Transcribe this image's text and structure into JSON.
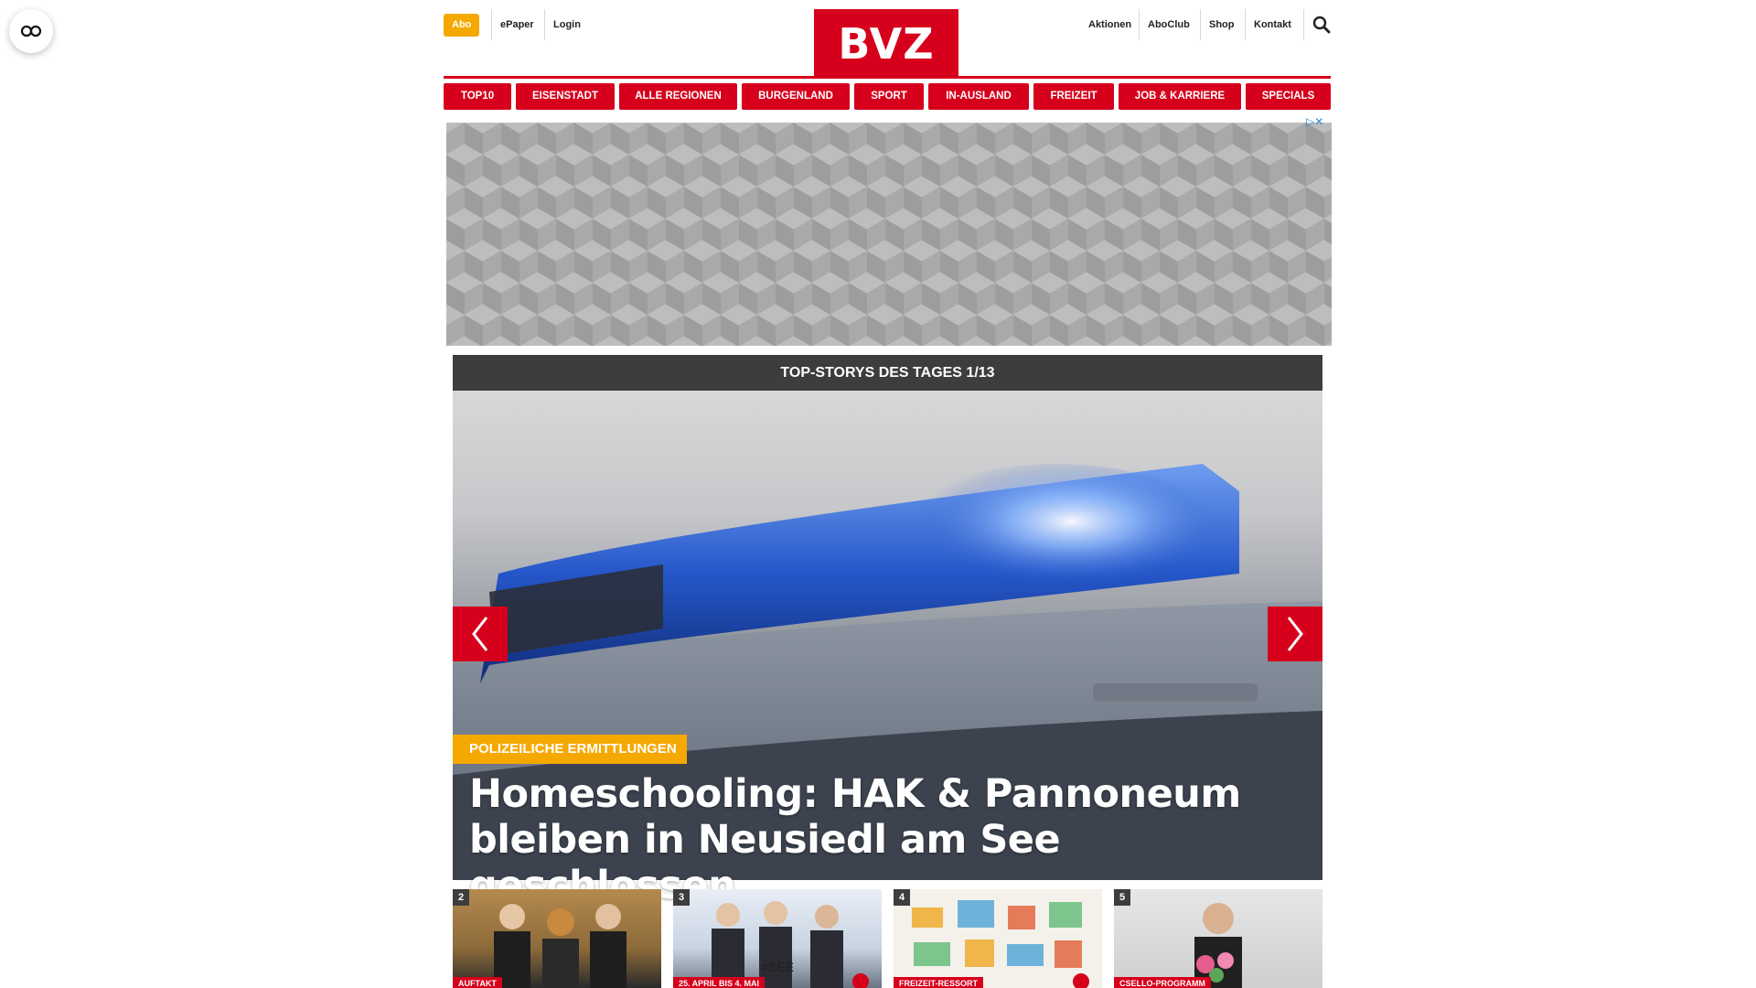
{
  "header": {
    "abo_label": "Abo",
    "epaper_label": "ePaper",
    "login_label": "Login",
    "logo_text": "BVZ",
    "right_links": [
      "Aktionen",
      "AboClub",
      "Shop",
      "Kontakt"
    ],
    "search_icon": "search-icon"
  },
  "nav": {
    "items": [
      "TOP10",
      "EISENSTADT",
      "ALLE REGIONEN",
      "BURGENLAND",
      "SPORT",
      "IN-AUSLAND",
      "FREIZEIT",
      "JOB & KARRIERE",
      "SPECIALS"
    ]
  },
  "ad": {
    "choice_label": "▷✕"
  },
  "top_stories": {
    "heading": "TOP-STORYS DES TAGES 1/13",
    "hero": {
      "kicker": "POLIZEILICHE ERMITTLUNGEN",
      "headline": "Homeschooling: HAK & Pannoneum bleiben in Neusiedl am See geschlossen"
    },
    "thumbnails": [
      {
        "number": "2",
        "tag": "AUFTAKT"
      },
      {
        "number": "3",
        "tag": "25. APRIL BIS 4. MAI"
      },
      {
        "number": "4",
        "tag": "FREIZEIT-RESSORT"
      },
      {
        "number": "5",
        "tag": "CSELLO-PROGRAMM"
      }
    ]
  },
  "colors": {
    "brand_red": "#d6001c",
    "accent_yellow": "#f5a800",
    "dark_bar": "#3d3d3d"
  }
}
